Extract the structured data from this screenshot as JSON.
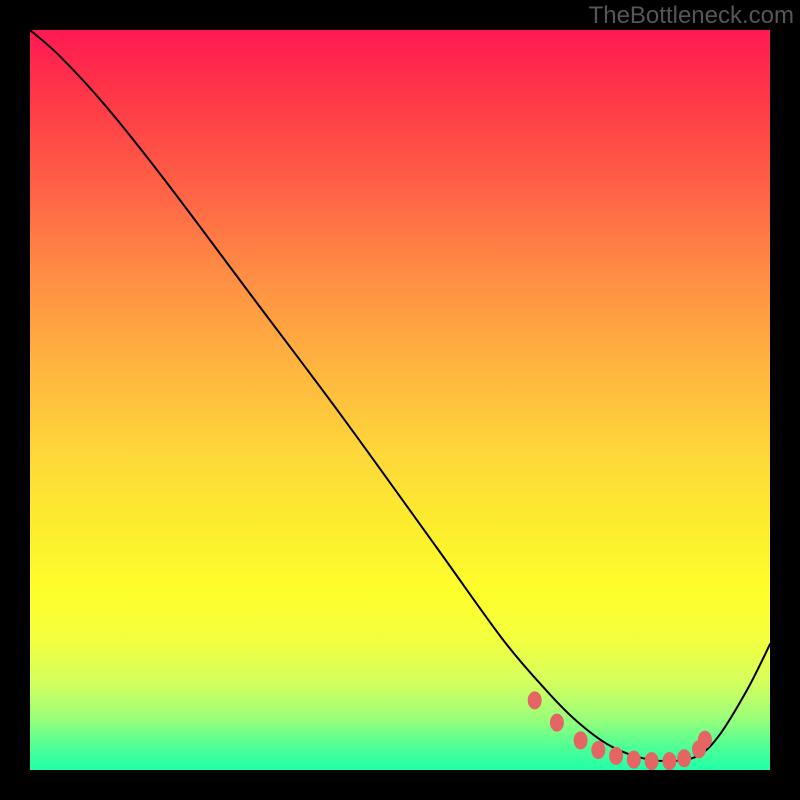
{
  "watermark": "TheBottleneck.com",
  "chart_data": {
    "type": "line",
    "title": "",
    "xlabel": "",
    "ylabel": "",
    "xlim": [
      0,
      1
    ],
    "ylim": [
      0,
      1
    ],
    "series": [
      {
        "name": "curve",
        "x": [
          0.0,
          0.04,
          0.1,
          0.18,
          0.3,
          0.42,
          0.55,
          0.64,
          0.7,
          0.74,
          0.78,
          0.82,
          0.86,
          0.9,
          0.93,
          0.97,
          1.0
        ],
        "y": [
          1.0,
          0.965,
          0.9,
          0.8,
          0.64,
          0.48,
          0.3,
          0.175,
          0.105,
          0.065,
          0.035,
          0.018,
          0.012,
          0.018,
          0.045,
          0.11,
          0.17
        ]
      }
    ],
    "markers": {
      "x": [
        0.682,
        0.712,
        0.744,
        0.768,
        0.792,
        0.816,
        0.84,
        0.864,
        0.884,
        0.904,
        0.912
      ],
      "y": [
        0.094,
        0.064,
        0.04,
        0.027,
        0.019,
        0.014,
        0.012,
        0.012,
        0.016,
        0.028,
        0.041
      ]
    },
    "gradient_stops": [
      {
        "pos": 0.0,
        "color": "#ff1a53"
      },
      {
        "pos": 0.1,
        "color": "#ff3b47"
      },
      {
        "pos": 0.21,
        "color": "#ff6046"
      },
      {
        "pos": 0.33,
        "color": "#ff8d44"
      },
      {
        "pos": 0.45,
        "color": "#ffb33f"
      },
      {
        "pos": 0.57,
        "color": "#fed73a"
      },
      {
        "pos": 0.67,
        "color": "#fced2e"
      },
      {
        "pos": 0.76,
        "color": "#fefe2c"
      },
      {
        "pos": 0.82,
        "color": "#f4ff3d"
      },
      {
        "pos": 0.88,
        "color": "#d6ff5c"
      },
      {
        "pos": 0.93,
        "color": "#9aff79"
      },
      {
        "pos": 0.97,
        "color": "#4dff96"
      },
      {
        "pos": 1.0,
        "color": "#20ffa7"
      }
    ]
  }
}
